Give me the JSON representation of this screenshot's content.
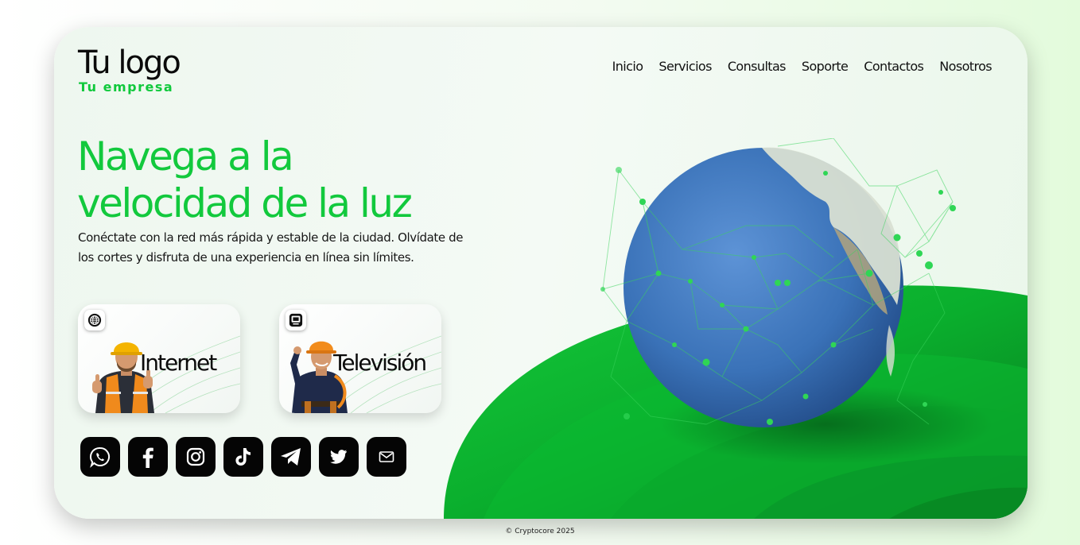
{
  "brand": {
    "logo": "Tu logo",
    "company": "Tu empresa"
  },
  "nav": {
    "items": [
      "Inicio",
      "Servicios",
      "Consultas",
      "Soporte",
      "Contactos",
      "Nosotros"
    ]
  },
  "hero": {
    "title_line1": "Navega a la",
    "title_line2": "velocidad de la luz",
    "description": "Conéctate con la red más rápida y estable de la ciudad. Olvídate de los cortes y disfruta de una experiencia en línea sin límites."
  },
  "services": [
    {
      "label": "Internet",
      "icon": "globe-icon"
    },
    {
      "label": "Televisión",
      "icon": "tv-icon"
    }
  ],
  "socials": [
    "whatsapp-icon",
    "facebook-icon",
    "instagram-icon",
    "tiktok-icon",
    "telegram-icon",
    "twitter-icon",
    "mail-icon"
  ],
  "footer": {
    "copyright": "© Cryptocore 2025"
  },
  "colors": {
    "accent": "#12c93d",
    "dark_green": "#08801f",
    "globe": "#3a72b8"
  }
}
